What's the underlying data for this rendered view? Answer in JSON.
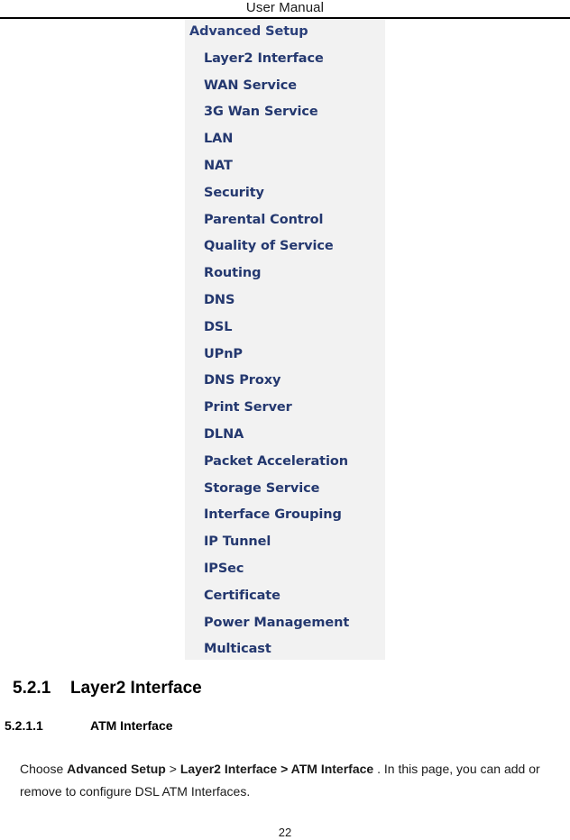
{
  "header": {
    "title": "User Manual"
  },
  "figure": {
    "name": "advanced-setup-menu-screenshot",
    "background_color": "#f2f2f2",
    "text_color": "#23408e",
    "menu_items": [
      {
        "label": "Advanced Setup",
        "level": 0
      },
      {
        "label": "Layer2 Interface",
        "level": 1
      },
      {
        "label": "WAN Service",
        "level": 1
      },
      {
        "label": "3G Wan Service",
        "level": 1
      },
      {
        "label": "LAN",
        "level": 1
      },
      {
        "label": "NAT",
        "level": 1
      },
      {
        "label": "Security",
        "level": 1
      },
      {
        "label": "Parental Control",
        "level": 1
      },
      {
        "label": "Quality of Service",
        "level": 1
      },
      {
        "label": "Routing",
        "level": 1
      },
      {
        "label": "DNS",
        "level": 1
      },
      {
        "label": "DSL",
        "level": 1
      },
      {
        "label": "UPnP",
        "level": 1
      },
      {
        "label": "DNS Proxy",
        "level": 1
      },
      {
        "label": "Print Server",
        "level": 1
      },
      {
        "label": "DLNA",
        "level": 1
      },
      {
        "label": "Packet Acceleration",
        "level": 1
      },
      {
        "label": "Storage Service",
        "level": 1
      },
      {
        "label": "Interface Grouping",
        "level": 1
      },
      {
        "label": "IP Tunnel",
        "level": 1
      },
      {
        "label": "IPSec",
        "level": 1
      },
      {
        "label": "Certificate",
        "level": 1
      },
      {
        "label": "Power Management",
        "level": 1
      },
      {
        "label": "Multicast",
        "level": 1
      }
    ]
  },
  "section": {
    "number": "5.2.1",
    "title": "Layer2 Interface"
  },
  "subsection": {
    "number": "5.2.1.1",
    "title": "ATM Interface"
  },
  "paragraph": {
    "lead": "Choose ",
    "path_1": "Advanced Setup",
    "separator": " > ",
    "path_2": "Layer2 Interface > ATM Interface",
    "tail": " . In this page, you can add or remove to configure DSL ATM Interfaces."
  },
  "footer": {
    "page_number": "22"
  }
}
